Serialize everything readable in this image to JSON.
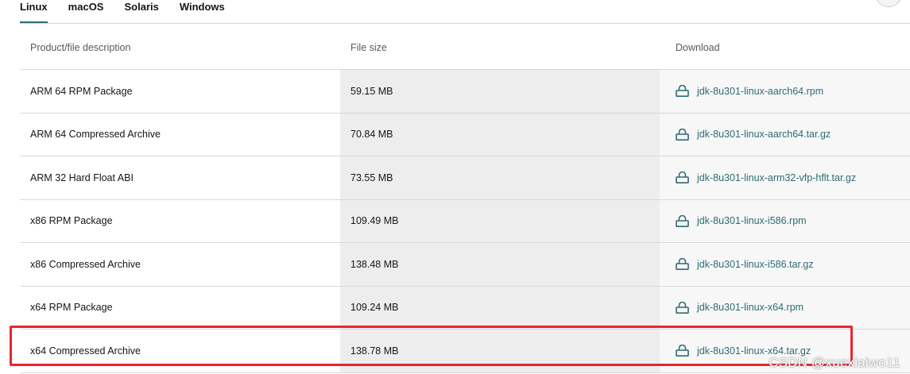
{
  "tabs": [
    {
      "label": "Linux",
      "active": true
    },
    {
      "label": "macOS",
      "active": false
    },
    {
      "label": "Solaris",
      "active": false
    },
    {
      "label": "Windows",
      "active": false
    }
  ],
  "table": {
    "headers": [
      "Product/file description",
      "File size",
      "Download"
    ],
    "rows": [
      {
        "description": "ARM 64 RPM Package",
        "size": "59.15 MB",
        "file": "jdk-8u301-linux-aarch64.rpm"
      },
      {
        "description": "ARM 64 Compressed Archive",
        "size": "70.84 MB",
        "file": "jdk-8u301-linux-aarch64.tar.gz"
      },
      {
        "description": "ARM 32 Hard Float ABI",
        "size": "73.55 MB",
        "file": "jdk-8u301-linux-arm32-vfp-hflt.tar.gz"
      },
      {
        "description": "x86 RPM Package",
        "size": "109.49 MB",
        "file": "jdk-8u301-linux-i586.rpm"
      },
      {
        "description": "x86 Compressed Archive",
        "size": "138.48 MB",
        "file": "jdk-8u301-linux-i586.tar.gz"
      },
      {
        "description": "x64 RPM Package",
        "size": "109.24 MB",
        "file": "jdk-8u301-linux-x64.rpm"
      },
      {
        "description": "x64 Compressed Archive",
        "size": "138.78 MB",
        "file": "jdk-8u301-linux-x64.tar.gz"
      }
    ]
  },
  "highlighted_row": "x64 Compressed Archive",
  "watermark": "CSDN @xuexiaiwo11",
  "colors": {
    "link": "#2e6b73",
    "highlight_border": "#e8262e",
    "size_column_bg": "#ededed",
    "download_column_bg": "#f7f7f7"
  },
  "icons": {
    "download_link": "lock-icon"
  }
}
